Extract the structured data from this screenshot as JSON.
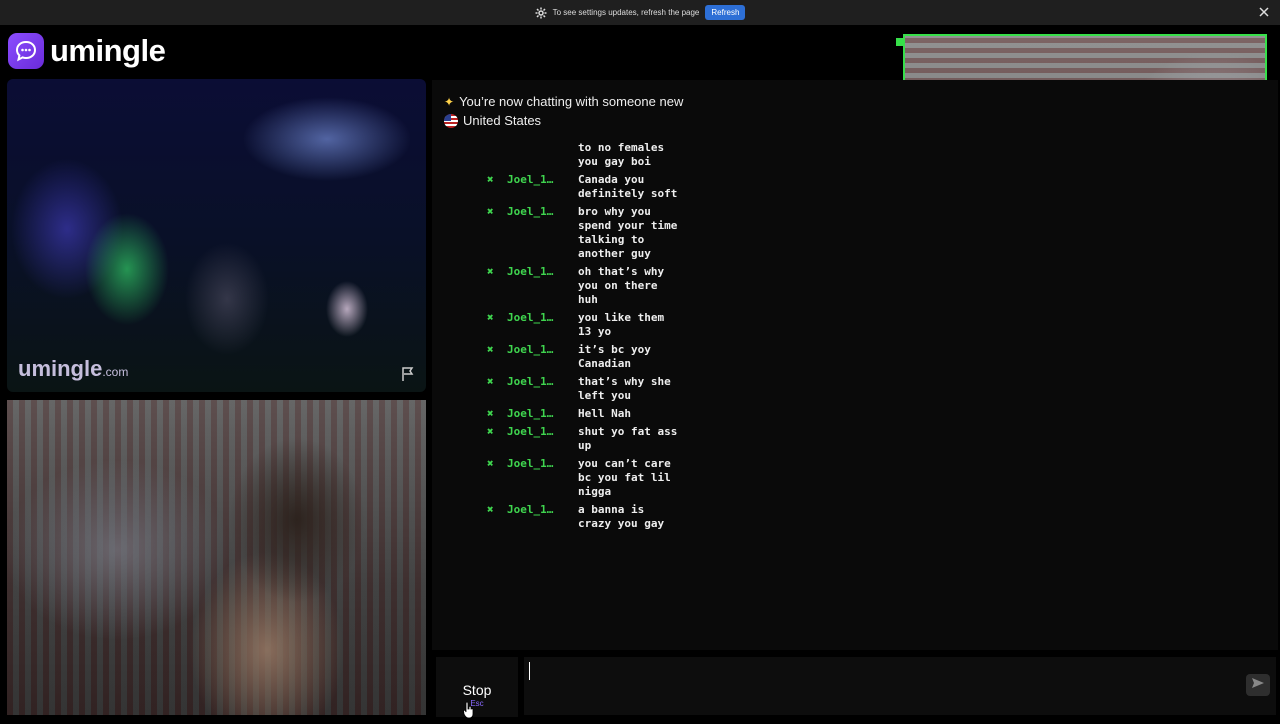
{
  "notification": {
    "message": "To see settings updates, refresh the page",
    "refresh_label": "Refresh"
  },
  "brand": {
    "name": "umingle",
    "watermark_name": "umingle",
    "watermark_domain": ".com"
  },
  "chat": {
    "status": "You’re now chatting with someone new",
    "country": "United States",
    "messages": [
      {
        "sender": "",
        "text": "to no females\nyou gay boi"
      },
      {
        "sender": "Joel_1…",
        "text": "Canada you\ndefinitely soft"
      },
      {
        "sender": "Joel_1…",
        "text": "bro why you\nspend your time\ntalking to\nanother guy"
      },
      {
        "sender": "Joel_1…",
        "text": "oh that’s why\nyou on there\nhuh"
      },
      {
        "sender": "Joel_1…",
        "text": "you like them\n13 yo"
      },
      {
        "sender": "Joel_1…",
        "text": "it’s bc yoy\nCanadian"
      },
      {
        "sender": "Joel_1…",
        "text": "that’s why she\nleft you"
      },
      {
        "sender": "Joel_1…",
        "text": "Hell Nah"
      },
      {
        "sender": "Joel_1…",
        "text": "shut yo fat ass\nup"
      },
      {
        "sender": "Joel_1…",
        "text": "you can’t care\nbc you fat lil\nnigga"
      },
      {
        "sender": "Joel_1…",
        "text": "a banna is\ncrazy you gay"
      }
    ]
  },
  "controls": {
    "stop_label": "Stop",
    "stop_key": "Esc",
    "input_value": ""
  },
  "colors": {
    "accent": "#8b4dff",
    "sender": "#3fd54f",
    "refresh": "#2d6fd6",
    "preview_border": "#37e04a"
  },
  "icons": {
    "settings": "gear-icon",
    "close": "close-icon",
    "report": "flag-icon",
    "send": "send-icon",
    "sparkle": "sparkle-icon"
  }
}
